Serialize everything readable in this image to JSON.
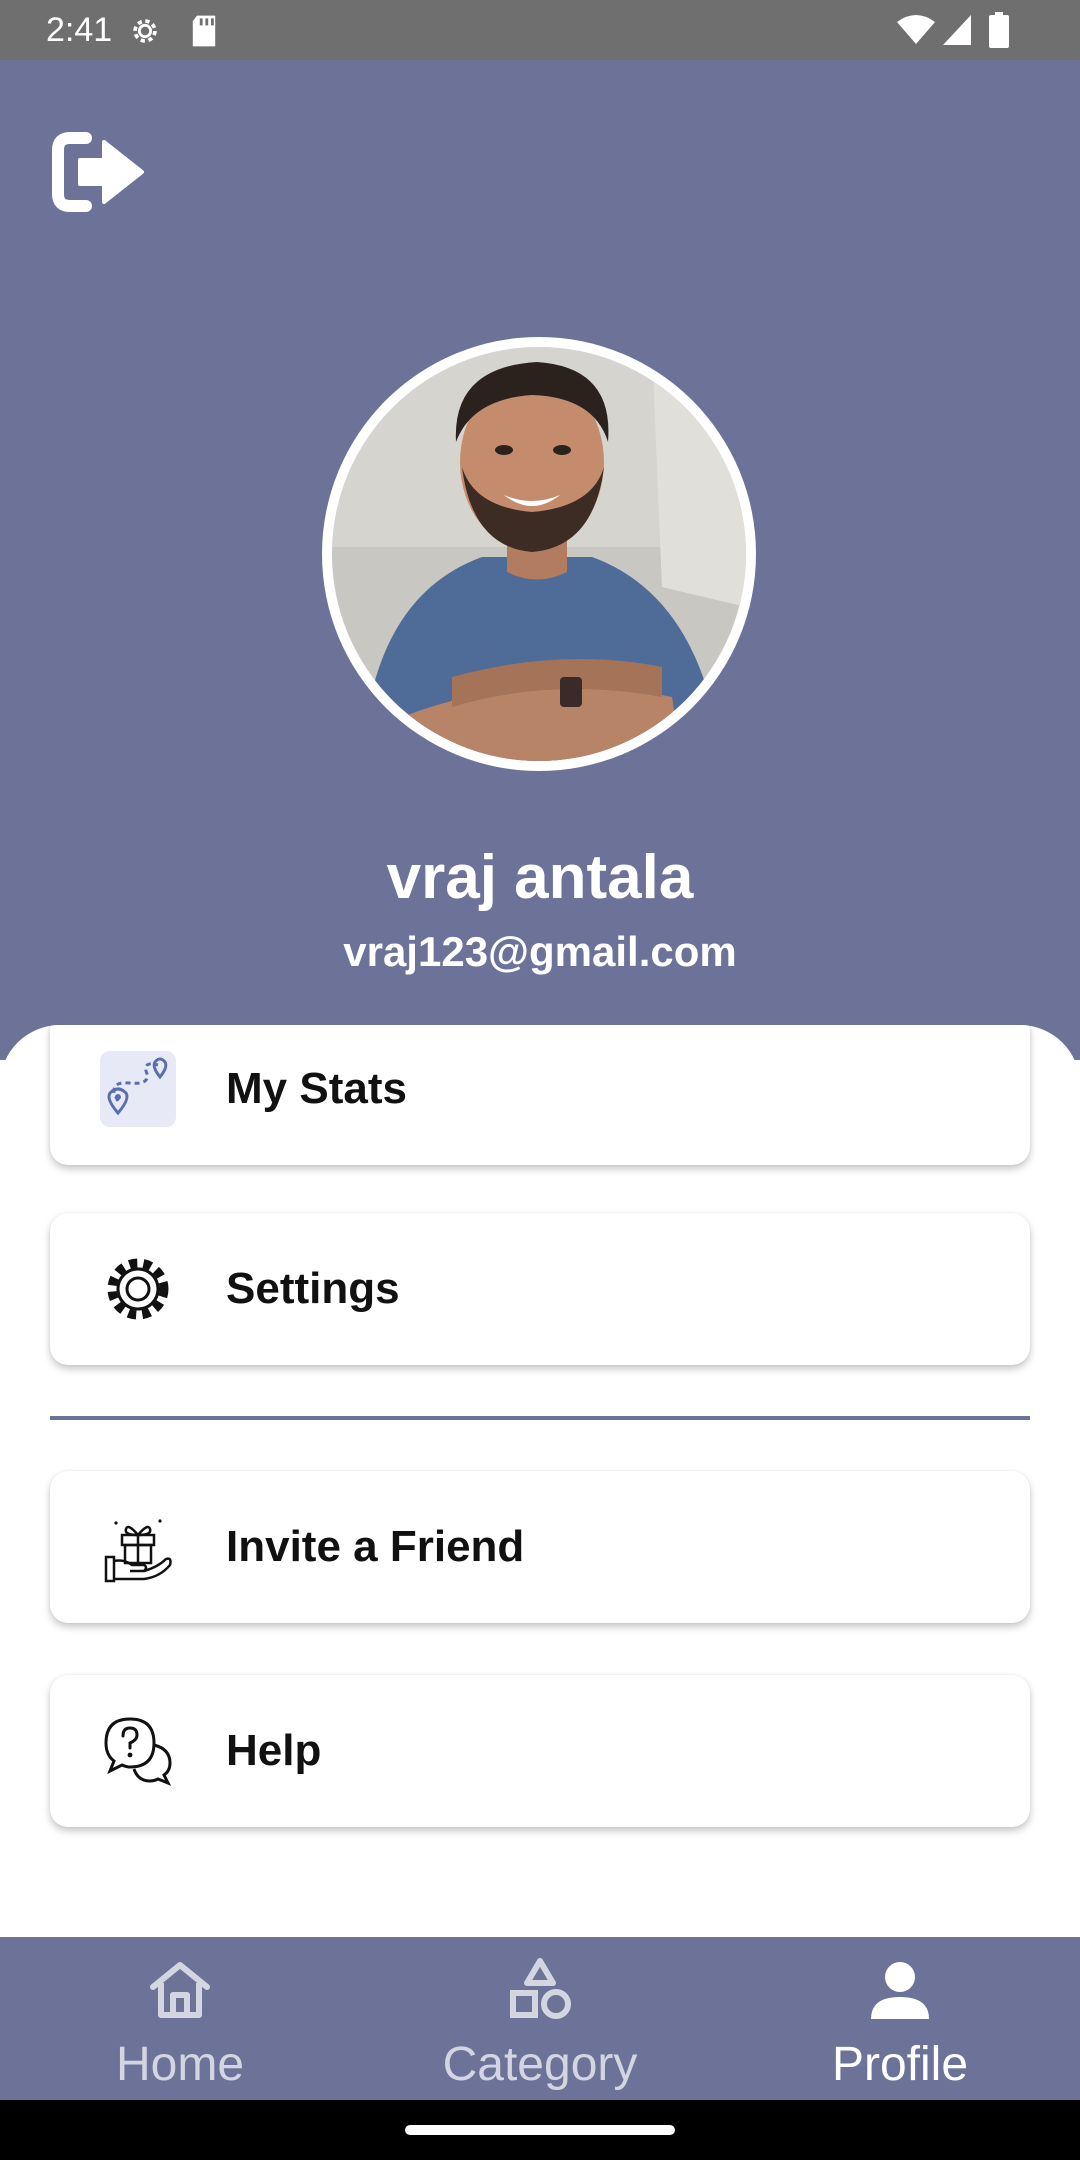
{
  "status_bar": {
    "time": "2:41",
    "icons": [
      "settings-gear-icon",
      "sd-card-icon",
      "wifi-icon",
      "cell-signal-icon",
      "battery-icon"
    ]
  },
  "header": {
    "background_color": "#6d7398",
    "logout_icon": "logout-icon",
    "user": {
      "name": "vraj antala",
      "email": "vraj123@gmail.com"
    }
  },
  "menu": {
    "items": [
      {
        "label": "My Stats",
        "icon": "route-map-icon"
      },
      {
        "label": "Settings",
        "icon": "gear-icon"
      },
      {
        "label": "Invite a Friend",
        "icon": "gift-hand-icon"
      },
      {
        "label": "Help",
        "icon": "help-chat-icon"
      }
    ]
  },
  "bottom_nav": {
    "items": [
      {
        "label": "Home",
        "icon": "home-icon",
        "active": false
      },
      {
        "label": "Category",
        "icon": "category-shapes-icon",
        "active": false
      },
      {
        "label": "Profile",
        "icon": "person-icon",
        "active": true
      }
    ]
  }
}
